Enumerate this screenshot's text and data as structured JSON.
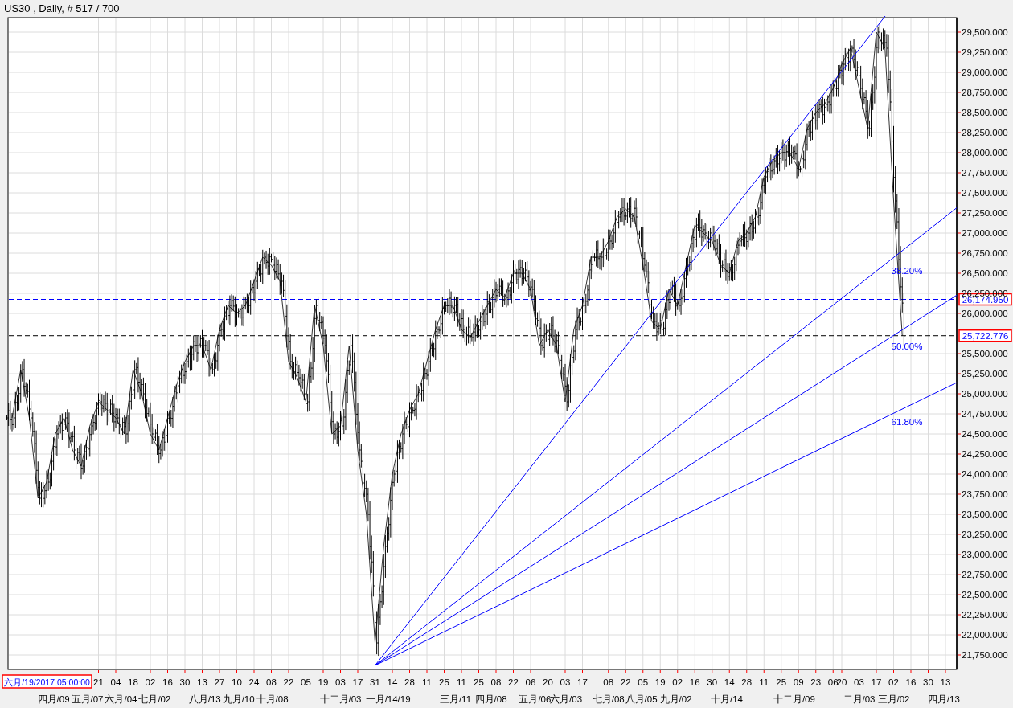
{
  "window": {
    "title": "US30 , Daily, # 517 / 700"
  },
  "chart": {
    "crosshair_label": "六月/19/2017 05:00:00",
    "chart_data": {
      "type": "line",
      "ylim": [
        21570,
        29680
      ],
      "grid": true,
      "categories": [
        null,
        null,
        null,
        null,
        null,
        null,
        null,
        null,
        null,
        null,
        "21",
        null,
        "04",
        null,
        "18",
        null,
        "02",
        null,
        "16",
        null,
        "30",
        null,
        "13",
        null,
        "27",
        null,
        "10",
        null,
        "24",
        null,
        "08",
        null,
        "22",
        null,
        "05",
        null,
        "19",
        null,
        "03",
        null,
        "17",
        null,
        "31",
        null,
        "14",
        null,
        "28",
        null,
        "11",
        null,
        "25",
        null,
        "11",
        null,
        "25",
        null,
        "08",
        null,
        "22",
        null,
        "06",
        null,
        "20",
        null,
        "03",
        null,
        "17",
        null,
        null,
        "08",
        null,
        "22",
        null,
        "05",
        null,
        "19",
        null,
        "02",
        null,
        "16",
        null,
        "30",
        null,
        "14",
        null,
        "28",
        null,
        "11",
        null,
        "25",
        null,
        "09",
        null,
        "23",
        null,
        "06",
        "20",
        null,
        "03",
        null,
        "17",
        null,
        "02",
        null,
        "16",
        null,
        "30",
        null,
        "13"
      ],
      "series": [
        {
          "color": "#000000",
          "values": [
            24700,
            25300,
            24700,
            23700,
            23900,
            24500,
            24700,
            24300,
            24100,
            24600,
            24900,
            24800,
            24700,
            24500,
            25300,
            25000,
            24500,
            24300,
            24700,
            25100,
            25400,
            25600,
            25600,
            25300,
            25800,
            26100,
            26000,
            26100,
            26400,
            26700,
            26600,
            26400,
            25400,
            25200,
            24900,
            26100,
            25600,
            24500,
            24600,
            25600,
            24300,
            23500,
            21900,
            23100,
            24000,
            24500,
            24800,
            25000,
            25400,
            25800,
            26100,
            26100,
            25800,
            25700,
            25900,
            26100,
            26300,
            26200,
            26500,
            26500,
            26300,
            25600,
            25800,
            25600,
            24900,
            25800,
            26100,
            26700,
            26700,
            26900,
            27200,
            27300,
            27200,
            26600,
            25900,
            25800,
            26300,
            26100,
            26600,
            27100,
            27000,
            26900,
            26600,
            26500,
            26900,
            27000,
            27200,
            27700,
            27900,
            28000,
            28000,
            27800,
            28300,
            28500,
            28600,
            28800,
            29100,
            29300,
            28800,
            28300,
            29500,
            29300,
            27400,
            25720,
            null,
            null,
            null,
            null,
            null
          ]
        }
      ],
      "yticks": [
        {
          "value": 29500,
          "label": "29,500.000"
        },
        {
          "value": 29250,
          "label": "29,250.000"
        },
        {
          "value": 29000,
          "label": "29,000.000"
        },
        {
          "value": 28750,
          "label": "28,750.000"
        },
        {
          "value": 28500,
          "label": "28,500.000"
        },
        {
          "value": 28250,
          "label": "28,250.000"
        },
        {
          "value": 28000,
          "label": "28,000.000"
        },
        {
          "value": 27750,
          "label": "27,750.000"
        },
        {
          "value": 27500,
          "label": "27,500.000"
        },
        {
          "value": 27250,
          "label": "27,250.000"
        },
        {
          "value": 27000,
          "label": "27,000.000"
        },
        {
          "value": 26750,
          "label": "26,750.000"
        },
        {
          "value": 26500,
          "label": "26,500.000"
        },
        {
          "value": 26250,
          "label": "26,250.000"
        },
        {
          "value": 26000,
          "label": "26,000.000"
        },
        {
          "value": 25500,
          "label": "25,500.000"
        },
        {
          "value": 25250,
          "label": "25,250.000"
        },
        {
          "value": 25000,
          "label": "25,000.000"
        },
        {
          "value": 24750,
          "label": "24,750.000"
        },
        {
          "value": 24500,
          "label": "24,500.000"
        },
        {
          "value": 24250,
          "label": "24,250.000"
        },
        {
          "value": 24000,
          "label": "24,000.000"
        },
        {
          "value": 23750,
          "label": "23,750.000"
        },
        {
          "value": 23500,
          "label": "23,500.000"
        },
        {
          "value": 23250,
          "label": "23,250.000"
        },
        {
          "value": 23000,
          "label": "23,000.000"
        },
        {
          "value": 22750,
          "label": "22,750.000"
        },
        {
          "value": 22500,
          "label": "22,500.000"
        },
        {
          "value": 22250,
          "label": "22,250.000"
        },
        {
          "value": 22000,
          "label": "22,000.000"
        },
        {
          "value": 21750,
          "label": "21,750.000"
        }
      ],
      "ref_lines": [
        {
          "axis": "y",
          "value": 26174.95,
          "label": "26,174.950",
          "color": "#0000ff"
        },
        {
          "axis": "y",
          "value": 25722.776,
          "label": "25,722.776",
          "color": "#000000"
        }
      ]
    },
    "month_labels": [
      "四月/09",
      "五月/07",
      "六月/04",
      "七月/02",
      "八月/13",
      "九月/10",
      "十月/08",
      "十二月/03",
      "一月/14/19",
      "三月/11",
      "四月/08",
      "五月/06",
      "六月/03",
      "七月/08",
      "八月/05",
      "九月/02",
      "十月/14",
      "十二月/09",
      "二月/03",
      "三月/02",
      "四月/13"
    ],
    "fibonacci_fan": {
      "color": "#0000ff",
      "level_labels": [
        "38.20%",
        "50.00%",
        "61.80%"
      ]
    }
  }
}
